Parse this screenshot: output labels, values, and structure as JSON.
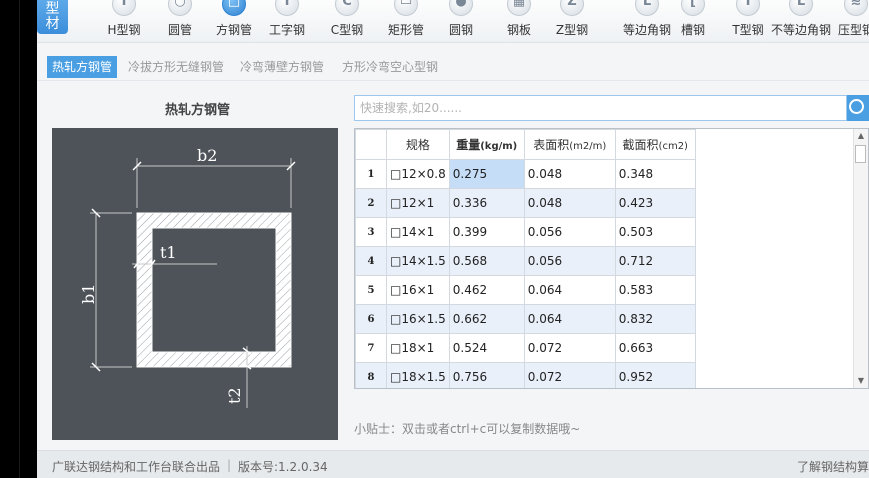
{
  "category_tab": "型\n材",
  "toolbar": [
    {
      "label": "H型钢",
      "glyph": "I",
      "icon": "h-beam-icon"
    },
    {
      "label": "圆管",
      "glyph": "○",
      "icon": "round-pipe-icon"
    },
    {
      "label": "方钢管",
      "glyph": "□",
      "icon": "square-pipe-icon",
      "active": true
    },
    {
      "label": "工字钢",
      "glyph": "I",
      "icon": "i-beam-icon"
    },
    {
      "label": "C型钢",
      "glyph": "C",
      "icon": "c-channel-icon"
    },
    {
      "label": "矩形管",
      "glyph": "▭",
      "icon": "rect-pipe-icon"
    },
    {
      "label": "圆钢",
      "glyph": "●",
      "icon": "round-bar-icon"
    },
    {
      "label": "钢板",
      "glyph": "▦",
      "icon": "steel-plate-icon"
    },
    {
      "label": "Z型钢",
      "glyph": "Z",
      "icon": "z-section-icon"
    },
    {
      "label": "等边角钢",
      "glyph": "L",
      "icon": "equal-angle-icon"
    },
    {
      "label": "槽钢",
      "glyph": "[",
      "icon": "channel-icon"
    },
    {
      "label": "T型钢",
      "glyph": "T",
      "icon": "t-section-icon"
    },
    {
      "label": "不等边角钢",
      "glyph": "L",
      "icon": "unequal-angle-icon"
    },
    {
      "label": "压型钢",
      "glyph": "≋",
      "icon": "profiled-steel-icon"
    }
  ],
  "subtabs": [
    {
      "label": "热轧方钢管",
      "active": true
    },
    {
      "label": "冷拔方形无缝钢管"
    },
    {
      "label": "冷弯薄壁方钢管"
    },
    {
      "label": "方形冷弯空心型钢"
    }
  ],
  "section_title": "热轧方钢管",
  "diagram": {
    "b2": "b2",
    "b1": "b1",
    "t1": "t1",
    "t2": "t2"
  },
  "search": {
    "placeholder": "快速搜索,如20......"
  },
  "table": {
    "headers": {
      "spec": "规格",
      "weight": "重量",
      "weight_unit": "(kg/m)",
      "surface": "表面积",
      "surface_unit": "(m2/m)",
      "section": "截面积",
      "section_unit": "(cm2)"
    },
    "rows": [
      {
        "idx": "1",
        "spec": "□12×0.8",
        "weight": "0.275",
        "surface": "0.048",
        "section": "0.348"
      },
      {
        "idx": "2",
        "spec": "□12×1",
        "weight": "0.336",
        "surface": "0.048",
        "section": "0.423"
      },
      {
        "idx": "3",
        "spec": "□14×1",
        "weight": "0.399",
        "surface": "0.056",
        "section": "0.503"
      },
      {
        "idx": "4",
        "spec": "□14×1.5",
        "weight": "0.568",
        "surface": "0.056",
        "section": "0.712"
      },
      {
        "idx": "5",
        "spec": "□16×1",
        "weight": "0.462",
        "surface": "0.064",
        "section": "0.583"
      },
      {
        "idx": "6",
        "spec": "□16×1.5",
        "weight": "0.662",
        "surface": "0.064",
        "section": "0.832"
      },
      {
        "idx": "7",
        "spec": "□18×1",
        "weight": "0.524",
        "surface": "0.072",
        "section": "0.663"
      },
      {
        "idx": "8",
        "spec": "□18×1.5",
        "weight": "0.756",
        "surface": "0.072",
        "section": "0.952"
      }
    ]
  },
  "tip": "小贴士：双击或者ctrl+c可以复制数据哦~",
  "footer": {
    "product": "广联达钢结构和工作台联合出品",
    "separator": "|",
    "version": "版本号:1.2.0.34",
    "link": "了解钢结构算"
  },
  "colors": {
    "accent": "#4a9fe3",
    "diagram_bg": "#4e5359",
    "row_alt": "#eaf0fa",
    "selected": "#c5ddf7"
  }
}
